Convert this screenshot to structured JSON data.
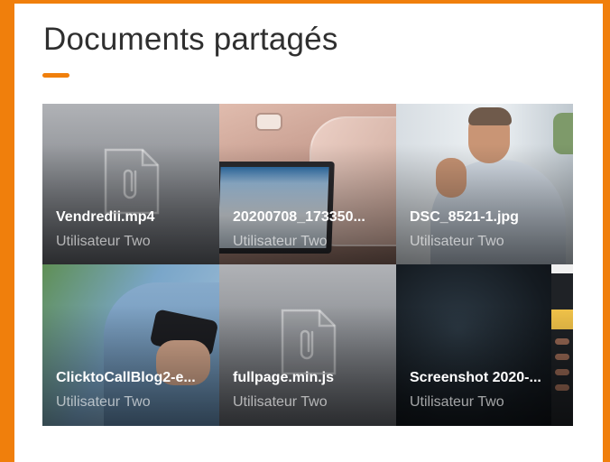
{
  "page": {
    "title": "Documents partagés",
    "accent_color": "#f07f0c"
  },
  "documents": [
    {
      "name": "Vendredii.mp4",
      "owner": "Utilisateur Two",
      "thumbnail": "paperclip-file-icon"
    },
    {
      "name": "20200708_173350...",
      "owner": "Utilisateur Two",
      "thumbnail": "photo-laptop"
    },
    {
      "name": "DSC_8521-1.jpg",
      "owner": "Utilisateur Two",
      "thumbnail": "photo-man-on-phone"
    },
    {
      "name": "ClicktoCallBlog2-e...",
      "owner": "Utilisateur Two",
      "thumbnail": "photo-hand-holding-phone"
    },
    {
      "name": "fullpage.min.js",
      "owner": "Utilisateur Two",
      "thumbnail": "paperclip-file-icon"
    },
    {
      "name": "Screenshot 2020-...",
      "owner": "Utilisateur Two",
      "thumbnail": "screenshot-dark"
    }
  ]
}
